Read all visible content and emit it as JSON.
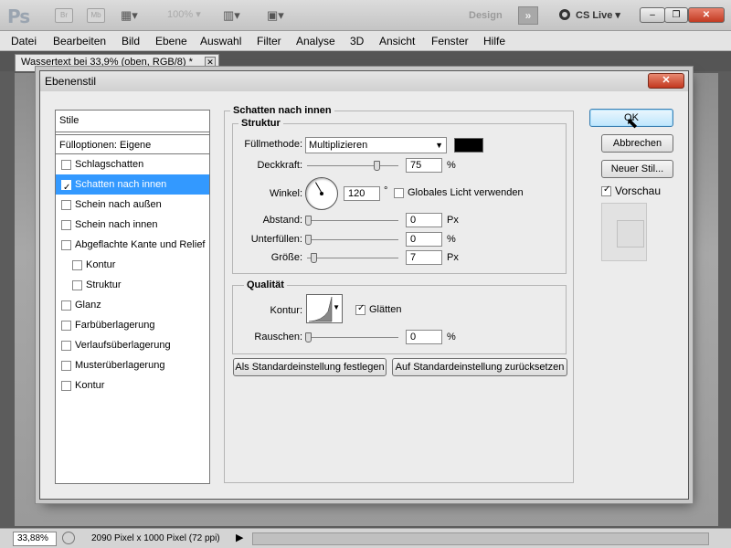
{
  "app": {
    "logo": "Ps",
    "bridge_btn": "Br",
    "minibridge_btn": "Mb",
    "zoom_level": "100%",
    "workspace": "Design",
    "more_workspaces": "»",
    "cs_live": "CS Live"
  },
  "window_controls": {
    "minimize": "–",
    "restore": "❐",
    "close": "✕"
  },
  "menu": [
    "Datei",
    "Bearbeiten",
    "Bild",
    "Ebene",
    "Auswahl",
    "Filter",
    "Analyse",
    "3D",
    "Ansicht",
    "Fenster",
    "Hilfe"
  ],
  "document_tab": {
    "title": "Wassertext bei 33,9% (oben, RGB/8) *",
    "close": "✕"
  },
  "status": {
    "zoom": "33,88%",
    "info": "2090 Pixel x 1000 Pixel (72 ppi)",
    "arrow": "▶"
  },
  "dialog": {
    "title": "Ebenenstil",
    "close": "✕",
    "styles_list": {
      "header": "Stile",
      "fill_options": "Fülloptionen: Eigene",
      "items": [
        {
          "label": "Schlagschatten",
          "checked": false,
          "selected": false,
          "sub": false
        },
        {
          "label": "Schatten nach innen",
          "checked": true,
          "selected": true,
          "sub": false
        },
        {
          "label": "Schein nach außen",
          "checked": false,
          "selected": false,
          "sub": false
        },
        {
          "label": "Schein nach innen",
          "checked": false,
          "selected": false,
          "sub": false
        },
        {
          "label": "Abgeflachte Kante und Relief",
          "checked": false,
          "selected": false,
          "sub": false
        },
        {
          "label": "Kontur",
          "checked": false,
          "selected": false,
          "sub": true
        },
        {
          "label": "Struktur",
          "checked": false,
          "selected": false,
          "sub": true
        },
        {
          "label": "Glanz",
          "checked": false,
          "selected": false,
          "sub": false
        },
        {
          "label": "Farbüberlagerung",
          "checked": false,
          "selected": false,
          "sub": false
        },
        {
          "label": "Verlaufsüberlagerung",
          "checked": false,
          "selected": false,
          "sub": false
        },
        {
          "label": "Musterüberlagerung",
          "checked": false,
          "selected": false,
          "sub": false
        },
        {
          "label": "Kontur",
          "checked": false,
          "selected": false,
          "sub": false
        }
      ]
    },
    "panel": {
      "title": "Schatten nach innen",
      "structure": {
        "title": "Struktur",
        "blend_mode_label": "Füllmethode:",
        "blend_mode_value": "Multiplizieren",
        "shadow_color": "#000000",
        "opacity_label": "Deckkraft:",
        "opacity_value": "75",
        "opacity_unit": "%",
        "angle_label": "Winkel:",
        "angle_value": "120",
        "angle_unit": "°",
        "global_light_label": "Globales Licht verwenden",
        "global_light_checked": false,
        "distance_label": "Abstand:",
        "distance_value": "0",
        "distance_unit": "Px",
        "choke_label": "Unterfüllen:",
        "choke_value": "0",
        "choke_unit": "%",
        "size_label": "Größe:",
        "size_value": "7",
        "size_unit": "Px"
      },
      "quality": {
        "title": "Qualität",
        "contour_label": "Kontur:",
        "antialias_label": "Glätten",
        "antialias_checked": true,
        "noise_label": "Rauschen:",
        "noise_value": "0",
        "noise_unit": "%"
      },
      "make_default": "Als Standardeinstellung festlegen",
      "reset_default": "Auf Standardeinstellung zurücksetzen"
    },
    "buttons": {
      "ok": "OK",
      "cancel": "Abbrechen",
      "new_style": "Neuer Stil...",
      "preview_label": "Vorschau",
      "preview_checked": true
    }
  }
}
